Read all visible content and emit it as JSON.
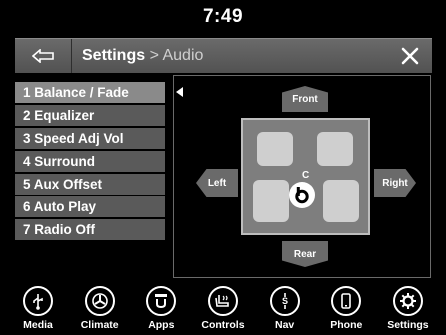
{
  "status": {
    "time": "7:49"
  },
  "header": {
    "back_icon": "back-arrow-icon",
    "breadcrumb": "Settings",
    "separator": " > ",
    "title": "Audio",
    "close_icon": "close-icon"
  },
  "menu": {
    "items": [
      {
        "label": "1 Balance / Fade",
        "active": true
      },
      {
        "label": "2 Equalizer"
      },
      {
        "label": "3 Speed Adj Vol"
      },
      {
        "label": "4 Surround"
      },
      {
        "label": "5 Aux Offset"
      },
      {
        "label": "6 Auto Play"
      },
      {
        "label": "7 Radio Off"
      }
    ]
  },
  "balance": {
    "front": "Front",
    "rear": "Rear",
    "left": "Left",
    "right": "Right",
    "center_label": "C",
    "logo_icon": "beats-logo-icon"
  },
  "dock": {
    "items": [
      {
        "label": "Media",
        "icon": "usb-icon"
      },
      {
        "label": "Climate",
        "icon": "fan-icon"
      },
      {
        "label": "Apps",
        "icon": "apps-icon"
      },
      {
        "label": "Controls",
        "icon": "seat-controls-icon"
      },
      {
        "label": "Nav",
        "icon": "nav-icon"
      },
      {
        "label": "Phone",
        "icon": "phone-icon"
      },
      {
        "label": "Settings",
        "icon": "gear-icon"
      }
    ]
  }
}
